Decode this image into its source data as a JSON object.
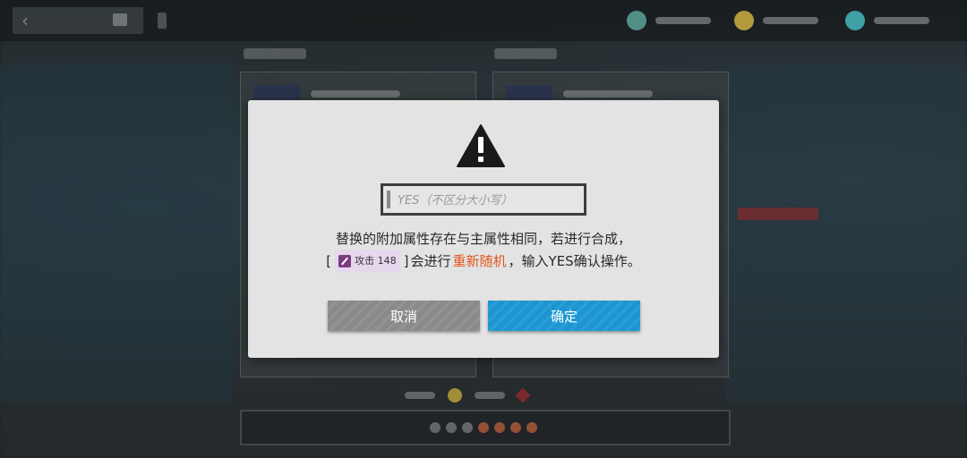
{
  "dialog": {
    "input_placeholder": "YES（不区分大小写）",
    "input_value": "",
    "message_line1": "替换的附加属性存在与主属性相同，若进行合成，",
    "message_bracket_open": "[",
    "attribute_tag": "攻击 148",
    "message_bracket_close": "]",
    "message_part_a": "会进行",
    "message_highlight": "重新随机",
    "message_part_b": "，输入YES确认操作。",
    "cancel_label": "取消",
    "confirm_label": "确定",
    "warning_icon": "warning-triangle-icon"
  },
  "colors": {
    "highlight": "#e2561d",
    "confirm_button": "#1f95cf",
    "cancel_button": "#8a8a8a",
    "dialog_bg": "#e3e3e3"
  }
}
